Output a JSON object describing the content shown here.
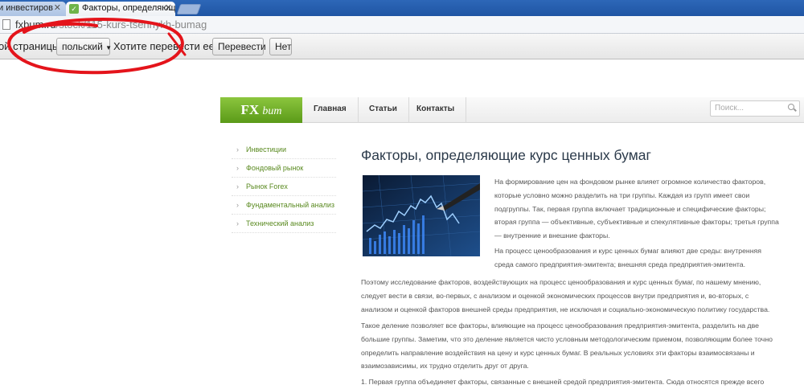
{
  "tabs": [
    {
      "title": "и инвестиров",
      "active": false
    },
    {
      "title": "Факторы, определяющие",
      "active": true
    }
  ],
  "address": {
    "host": "fxbum.ru",
    "path": "/stock/115-kurs-tsennykh-bumag"
  },
  "translate": {
    "prefix": "ой страницы",
    "language": "польский",
    "question": "Хотите перевести ее?",
    "translate_button": "Перевести",
    "no_button": "Нет"
  },
  "site": {
    "logo_fx": "FX",
    "logo_bum": "bum",
    "nav": [
      "Главная",
      "Статьи",
      "Контакты"
    ],
    "search_placeholder": "Поиск...",
    "sidebar": [
      "Инвестиции",
      "Фондовый рынок",
      "Рынок Forex",
      "Фундаментальный анализ",
      "Технический анализ"
    ]
  },
  "article": {
    "title": "Факторы, определяющие курс ценных бумаг",
    "p1": [
      "На формирование цен на фондовом рынке влияет огромное количество факторов,",
      "которые условно можно разделить на три группы. Каждая из групп имеет свои",
      "подгруппы. Так, первая группа включает традиционные и специфические факторы;",
      "вторая группа — объективные, субъективные и спекулятивные факторы; третья группа",
      "— внутренние и внешние факторы."
    ],
    "p2": [
      "На процесс ценообразования и курс ценных бумаг влияют две среды: внутренняя",
      "среда самого предприятия-эмитента; внешняя среда предприятия-эмитента."
    ],
    "p3": [
      "Поэтому исследование факторов, воздействующих на процесс ценообразования и курс ценных бумаг, по нашему мнению,",
      "следует вести в связи, во-первых, с анализом и оценкой экономических процессов внутри предприятия и, во-вторых, с",
      "анализом и оценкой факторов внешней среды предприятия, не исключая и социально-экономическую политику государства."
    ],
    "p4": [
      "Такое деление позволяет все факторы, влияющие на процесс ценообразования предприятия-эмитента, разделить на две",
      "большие группы. Заметим, что это деление является чисто условным методологическим приемом, позволяющим более точно",
      "определить направление воздействия на цену и курс ценных бумаг. В реальных условиях эти факторы взаимосвязаны и",
      "взаимозависимы, их трудно отделить друг от друга."
    ],
    "p5": [
      "1. Первая группа объединяет факторы, связанные с внешней средой предприятия-эмитента. Сюда относятся прежде всего"
    ]
  }
}
